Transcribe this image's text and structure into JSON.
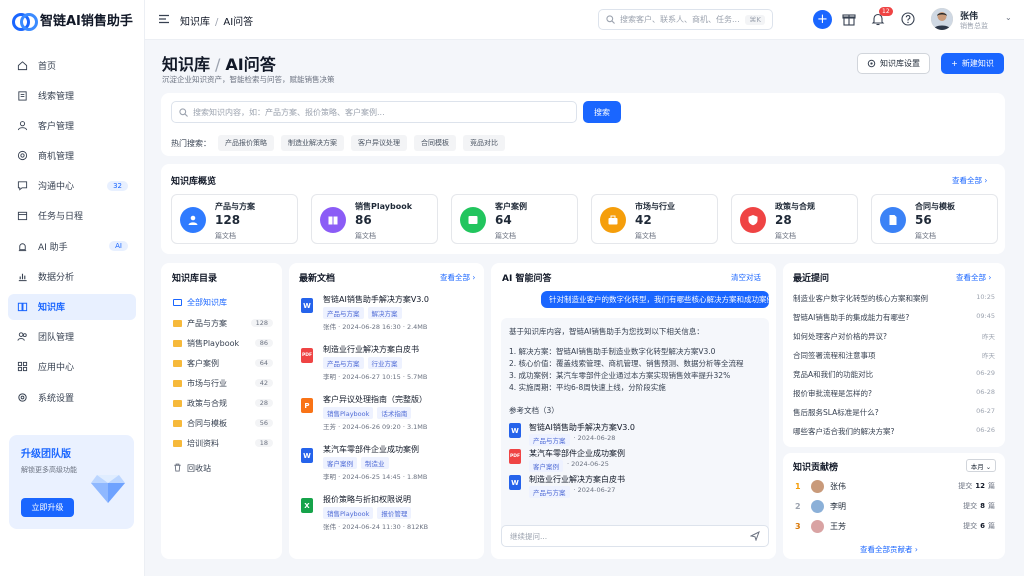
{
  "app": {
    "name": "智链AI销售助手"
  },
  "sidebar": {
    "items": [
      {
        "label": "首页",
        "icon": "home-icon"
      },
      {
        "label": "线索管理",
        "icon": "clipboard-icon"
      },
      {
        "label": "客户管理",
        "icon": "user-icon"
      },
      {
        "label": "商机管理",
        "icon": "target-icon"
      },
      {
        "label": "沟通中心",
        "icon": "chat-icon",
        "badge": "32"
      },
      {
        "label": "任务与日程",
        "icon": "calendar-icon"
      },
      {
        "label": "AI 助手",
        "icon": "bot-icon",
        "badge": "AI"
      },
      {
        "label": "数据分析",
        "icon": "bar-chart-icon"
      },
      {
        "label": "知识库",
        "icon": "book-icon",
        "active": true
      },
      {
        "label": "团队管理",
        "icon": "team-icon"
      },
      {
        "label": "应用中心",
        "icon": "grid-icon"
      },
      {
        "label": "系统设置",
        "icon": "gear-icon"
      }
    ],
    "upgrade": {
      "title": "升级团队版",
      "subtitle": "解锁更多高级功能",
      "button": "立即升级"
    }
  },
  "topbar": {
    "breadcrumb": [
      "知识库",
      "AI问答"
    ],
    "search_placeholder": "搜索客户、联系人、商机、任务...",
    "search_shortcut": "⌘K",
    "bell_badge": "12",
    "user": {
      "name": "张伟",
      "role": "销售总监"
    }
  },
  "page": {
    "title_a": "知识库",
    "title_b": "AI问答",
    "subtitle": "沉淀企业知识资产，智能检索与问答，赋能销售决策",
    "settings_button": "知识库设置",
    "new_button": "新建知识"
  },
  "search": {
    "placeholder": "搜索知识内容，如：产品方案、报价策略、客户案例...",
    "button": "搜索",
    "hot_label": "热门搜索：",
    "hot": [
      "产品报价策略",
      "制造业解决方案",
      "客户异议处理",
      "合同模板",
      "竞品对比"
    ]
  },
  "overview": {
    "title": "知识库概览",
    "view_all": "查看全部 ›",
    "cards": [
      {
        "name": "产品与方案",
        "count": "128",
        "unit": "篇文档",
        "color": "#2f7bff",
        "icon": "user-icon"
      },
      {
        "name": "销售Playbook",
        "count": "86",
        "unit": "篇文档",
        "color": "#8b5cf6",
        "icon": "book-icon"
      },
      {
        "name": "客户案例",
        "count": "64",
        "unit": "篇文档",
        "color": "#22c55e",
        "icon": "case-icon"
      },
      {
        "name": "市场与行业",
        "count": "42",
        "unit": "篇文档",
        "color": "#f59e0b",
        "icon": "briefcase-icon"
      },
      {
        "name": "政策与合规",
        "count": "28",
        "unit": "篇文档",
        "color": "#ef4444",
        "icon": "shield-icon"
      },
      {
        "name": "合同与模板",
        "count": "56",
        "unit": "篇文档",
        "color": "#3b82f6",
        "icon": "document-icon"
      }
    ]
  },
  "directory": {
    "title": "知识库目录",
    "items": [
      {
        "label": "全部知识库",
        "count": ""
      },
      {
        "label": "产品与方案",
        "count": "128"
      },
      {
        "label": "销售Playbook",
        "count": "86"
      },
      {
        "label": "客户案例",
        "count": "64"
      },
      {
        "label": "市场与行业",
        "count": "42"
      },
      {
        "label": "政策与合规",
        "count": "28"
      },
      {
        "label": "合同与模板",
        "count": "56"
      },
      {
        "label": "培训资料",
        "count": "18"
      },
      {
        "label": "回收站",
        "count": ""
      }
    ]
  },
  "latest": {
    "title": "最新文档",
    "view_all": "查看全部 ›",
    "docs": [
      {
        "title": "智链AI销售助手解决方案V3.0",
        "type": "W",
        "color": "#2563eb",
        "tags": [
          "产品与方案",
          "解决方案"
        ],
        "meta": "张伟 · 2024-06-28 16:30 · 2.4MB"
      },
      {
        "title": "制造业行业解决方案白皮书",
        "type": "PDF",
        "color": "#ef4444",
        "tags": [
          "产品与方案",
          "行业方案"
        ],
        "meta": "李明 · 2024-06-27 10:15 · 5.7MB"
      },
      {
        "title": "客户异议处理指南（完整版）",
        "type": "P",
        "color": "#f97316",
        "tags": [
          "销售Playbook",
          "话术指南"
        ],
        "meta": "王芳 · 2024-06-26 09:20 · 3.1MB"
      },
      {
        "title": "某汽车零部件企业成功案例",
        "type": "W",
        "color": "#2563eb",
        "tags": [
          "客户案例",
          "制造业"
        ],
        "meta": "李明 · 2024-06-25 14:45 · 1.8MB"
      },
      {
        "title": "报价策略与折扣权限说明",
        "type": "X",
        "color": "#16a34a",
        "tags": [
          "销售Playbook",
          "报价管理"
        ],
        "meta": "张伟 · 2024-06-24 11:30 · 812KB"
      }
    ]
  },
  "ai": {
    "title": "AI 智能问答",
    "clear": "清空对话",
    "question": "针对制造业客户的数字化转型，我们有哪些核心解决方案和成功案例?",
    "answer_intro": "基于知识库内容，智链AI销售助手为您找到以下相关信息：",
    "answer_points": [
      "1. 解决方案：智链AI销售助手制造业数字化转型解决方案V3.0",
      "2. 核心价值：覆盖线索管理、商机管理、销售预测、数据分析等全流程",
      "3. 成功案例：某汽车零部件企业通过本方案实现销售效率提升32%",
      "4. 实施周期：平均6-8周快速上线，分阶段实施"
    ],
    "refs_title": "参考文档（3）",
    "refs": [
      {
        "title": "智链AI销售助手解决方案V3.0",
        "type": "W",
        "color": "#2563eb",
        "tag": "产品与方案",
        "date": "2024-06-28"
      },
      {
        "title": "某汽车零部件企业成功案例",
        "type": "PDF",
        "color": "#ef4444",
        "tag": "客户案例",
        "date": "2024-06-25"
      },
      {
        "title": "制造业行业解决方案白皮书",
        "type": "W",
        "color": "#2563eb",
        "tag": "产品与方案",
        "date": "2024-06-27"
      }
    ],
    "input_placeholder": "继续提问..."
  },
  "recent": {
    "title": "最近提问",
    "view_all": "查看全部 ›",
    "items": [
      {
        "q": "制造业客户数字化转型的核心方案和案例",
        "t": "10:25"
      },
      {
        "q": "智链AI销售助手的集成能力有哪些?",
        "t": "09:45"
      },
      {
        "q": "如何处理客户对价格的异议?",
        "t": "昨天"
      },
      {
        "q": "合同签署流程和注意事项",
        "t": "昨天"
      },
      {
        "q": "竞品A和我们的功能对比",
        "t": "06-29"
      },
      {
        "q": "报价审批流程是怎样的?",
        "t": "06-28"
      },
      {
        "q": "售后服务SLA标准是什么?",
        "t": "06-27"
      },
      {
        "q": "哪些客户适合我们的解决方案?",
        "t": "06-26"
      }
    ]
  },
  "contrib": {
    "title": "知识贡献榜",
    "period": "本月 ⌄",
    "prefix": "提交",
    "suffix": "篇",
    "rows": [
      {
        "rank": "1",
        "name": "张伟",
        "count": "12",
        "color": "#f59e0b"
      },
      {
        "rank": "2",
        "name": "李明",
        "count": "8",
        "color": "#9ca3af"
      },
      {
        "rank": "3",
        "name": "王芳",
        "count": "6",
        "color": "#d97706"
      }
    ],
    "view_all": "查看全部贡献者 ›"
  }
}
